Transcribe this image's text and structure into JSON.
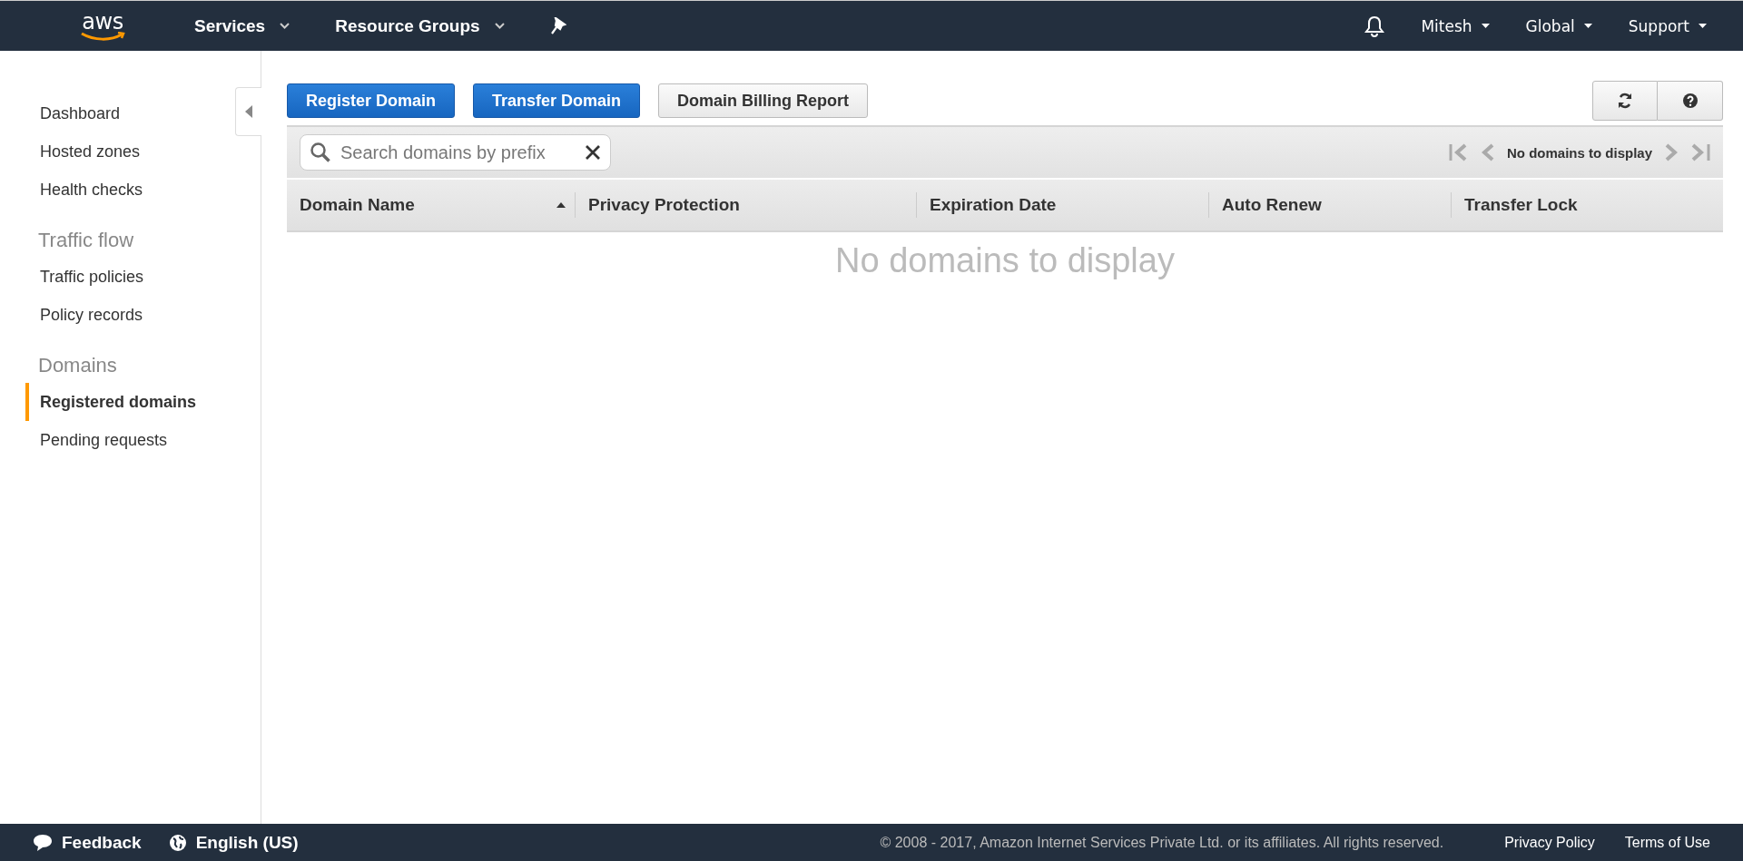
{
  "header": {
    "logo": "aws",
    "menus": [
      {
        "label": "Services"
      },
      {
        "label": "Resource Groups"
      }
    ],
    "right_menus": [
      {
        "label": "Mitesh"
      },
      {
        "label": "Global"
      },
      {
        "label": "Support"
      }
    ]
  },
  "sidebar": {
    "items": [
      {
        "kind": "link",
        "label": "Dashboard",
        "selected": false
      },
      {
        "kind": "link",
        "label": "Hosted zones",
        "selected": false
      },
      {
        "kind": "link",
        "label": "Health checks",
        "selected": false
      },
      {
        "kind": "heading",
        "label": "Traffic flow"
      },
      {
        "kind": "link",
        "label": "Traffic policies",
        "selected": false
      },
      {
        "kind": "link",
        "label": "Policy records",
        "selected": false
      },
      {
        "kind": "heading",
        "label": "Domains"
      },
      {
        "kind": "link",
        "label": "Registered domains",
        "selected": true
      },
      {
        "kind": "link",
        "label": "Pending requests",
        "selected": false
      }
    ]
  },
  "actions": [
    {
      "label": "Register Domain",
      "kind": "primary"
    },
    {
      "label": "Transfer Domain",
      "kind": "primary"
    },
    {
      "label": "Domain Billing Report",
      "kind": "secondary"
    }
  ],
  "search": {
    "placeholder": "Search domains by prefix"
  },
  "pager": {
    "text": "No domains to display"
  },
  "table": {
    "columns": [
      {
        "label": "Domain Name",
        "sorted": true
      },
      {
        "label": "Privacy Protection",
        "sorted": false
      },
      {
        "label": "Expiration Date",
        "sorted": false
      },
      {
        "label": "Auto Renew",
        "sorted": false
      },
      {
        "label": "Transfer Lock",
        "sorted": false
      }
    ],
    "empty_text": "No domains to display"
  },
  "footer": {
    "left": [
      {
        "kind": "feedback",
        "label": "Feedback"
      },
      {
        "kind": "language",
        "label": "English (US)"
      }
    ],
    "copyright": "© 2008 - 2017, Amazon Internet Services Private Ltd. or its affiliates. All rights reserved.",
    "links": [
      "Privacy Policy",
      "Terms of Use"
    ]
  }
}
